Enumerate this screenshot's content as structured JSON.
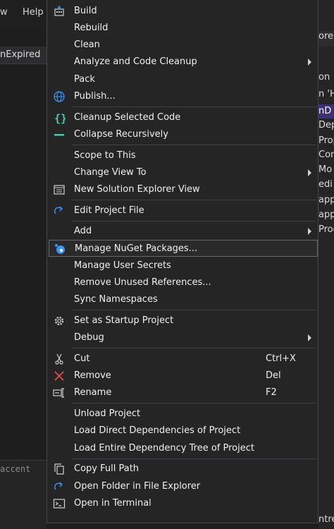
{
  "left_window": {
    "menubar": {
      "view_label": "w",
      "help_label": "Help"
    },
    "tab_label": "nExpired",
    "bottom_text": "accent"
  },
  "right_panel": {
    "lines": [
      "ore",
      "on",
      "n 'H",
      "nD",
      "Dep",
      "Prop",
      "Con",
      "Mo",
      "edi",
      "app",
      "app",
      "Prog",
      "ntre"
    ]
  },
  "menu": {
    "build": "Build",
    "rebuild": "Rebuild",
    "clean": "Clean",
    "analyze": "Analyze and Code Cleanup",
    "pack": "Pack",
    "publish": "Publish...",
    "cleanup_selected": "Cleanup Selected Code",
    "collapse": "Collapse Recursively",
    "scope": "Scope to This",
    "change_view": "Change View To",
    "new_view": "New Solution Explorer View",
    "edit_project": "Edit Project File",
    "add": "Add",
    "manage_nuget": "Manage NuGet Packages...",
    "manage_secrets": "Manage User Secrets",
    "remove_unused": "Remove Unused References...",
    "sync_ns": "Sync Namespaces",
    "startup": "Set as Startup Project",
    "debug": "Debug",
    "cut": "Cut",
    "cut_shortcut": "Ctrl+X",
    "remove": "Remove",
    "remove_shortcut": "Del",
    "rename": "Rename",
    "rename_shortcut": "F2",
    "unload": "Unload Project",
    "load_direct": "Load Direct Dependencies of Project",
    "load_entire": "Load Entire Dependency Tree of Project",
    "copy_path": "Copy Full Path",
    "open_folder": "Open Folder in File Explorer",
    "open_terminal": "Open in Terminal"
  },
  "colors": {
    "menu_bg": "#252526",
    "accent_blue": "#3794ff",
    "accent_teal": "#4ec9b0",
    "remove_red": "#f14c4c"
  }
}
